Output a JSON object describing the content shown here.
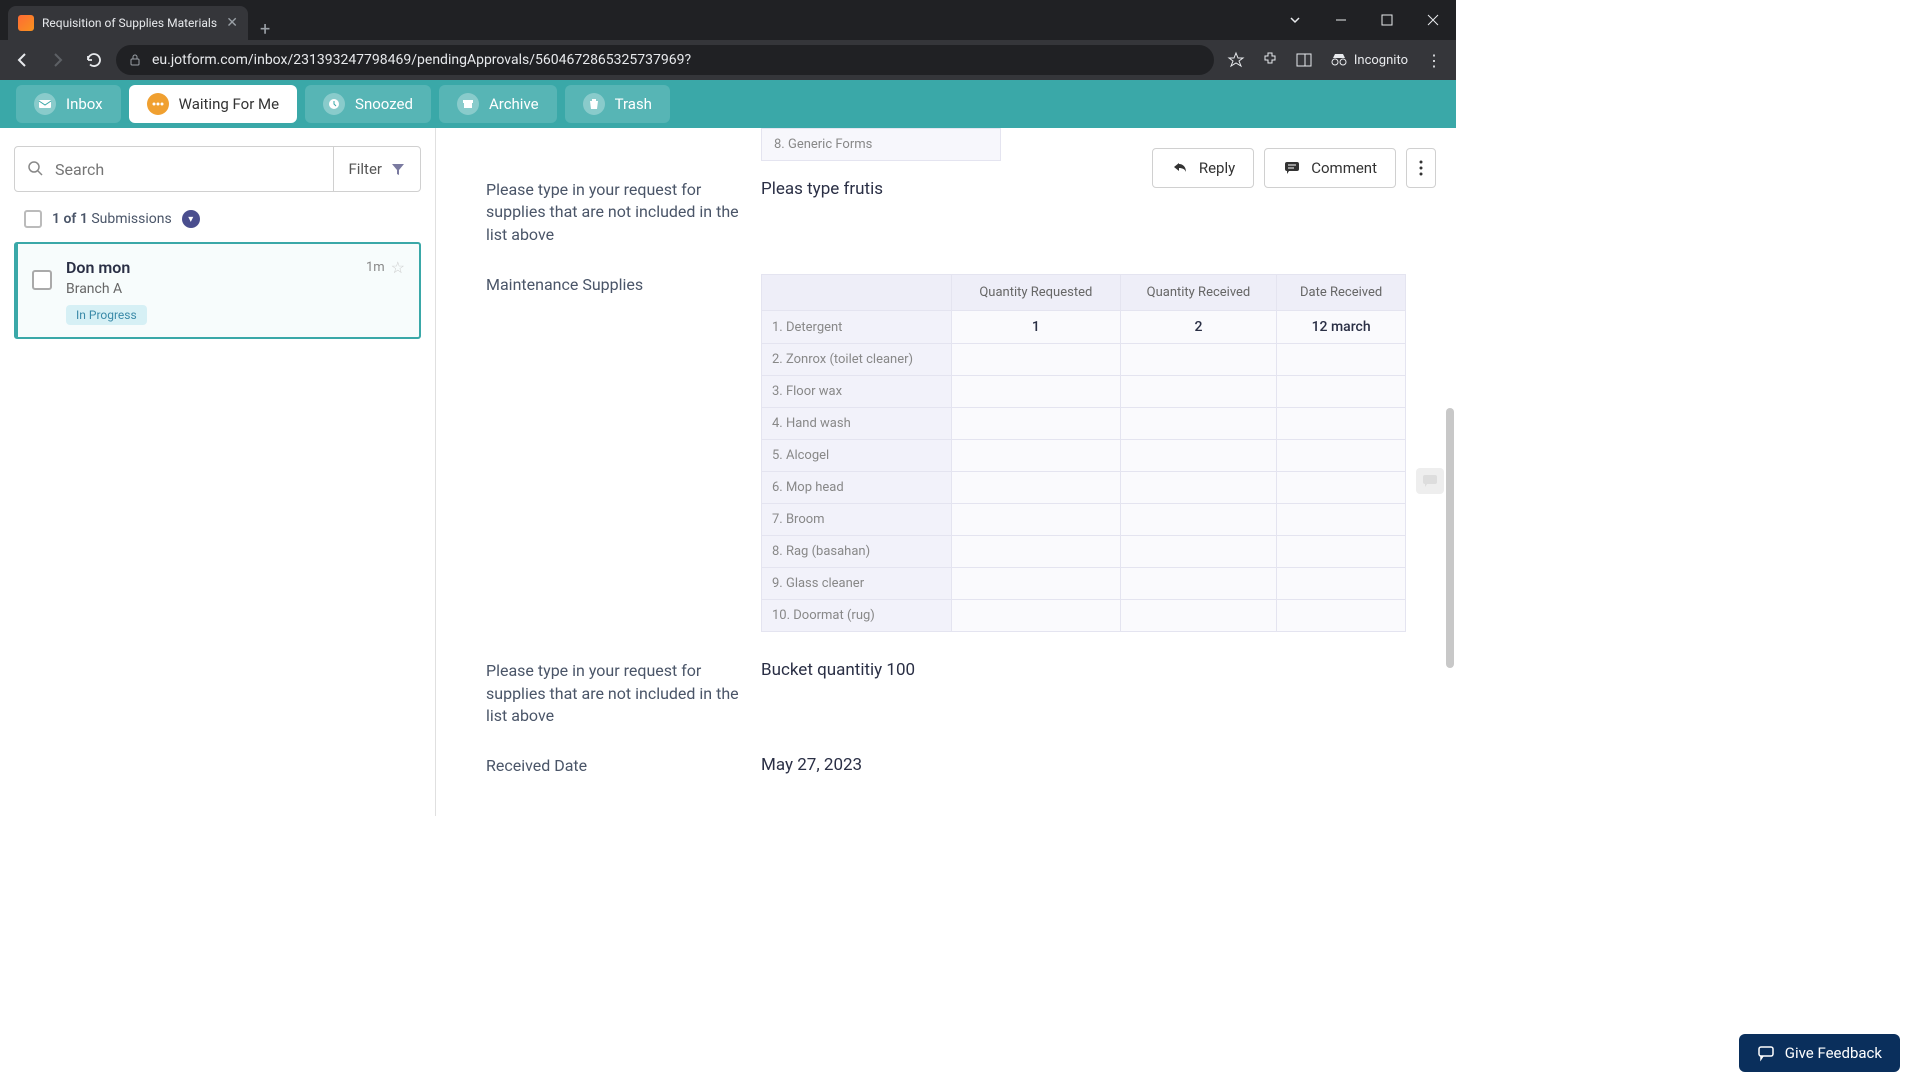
{
  "browser": {
    "tab_title": "Requisition of Supplies Materials",
    "url_display": "eu.jotform.com/inbox/231393247798469/pendingApprovals/5604672865325737969?",
    "incognito_label": "Incognito"
  },
  "nav": {
    "inbox": "Inbox",
    "waiting": "Waiting For Me",
    "snoozed": "Snoozed",
    "archive": "Archive",
    "trash": "Trash"
  },
  "sidebar": {
    "search_placeholder": "Search",
    "filter_label": "Filter",
    "count_prefix": "1 of 1",
    "count_suffix": "Submissions",
    "card": {
      "name": "Don mon",
      "time": "1m",
      "branch": "Branch A",
      "status": "In Progress"
    }
  },
  "toolbar": {
    "reply": "Reply",
    "comment": "Comment"
  },
  "content": {
    "generic_forms_row": "8. Generic Forms",
    "q1_label": "Please type in your request for supplies that are not included in the list above",
    "q1_value": "Pleas type frutis",
    "maint_label": "Maintenance Supplies",
    "maint_headers": [
      "",
      "Quantity Requested",
      "Quantity Received",
      "Date Received"
    ],
    "maint_rows": [
      {
        "label": "1. Detergent",
        "req": "1",
        "recv": "2",
        "date": "12 march"
      },
      {
        "label": "2. Zonrox (toilet cleaner)",
        "req": "",
        "recv": "",
        "date": ""
      },
      {
        "label": "3. Floor wax",
        "req": "",
        "recv": "",
        "date": ""
      },
      {
        "label": "4. Hand wash",
        "req": "",
        "recv": "",
        "date": ""
      },
      {
        "label": "5. Alcogel",
        "req": "",
        "recv": "",
        "date": ""
      },
      {
        "label": "6. Mop head",
        "req": "",
        "recv": "",
        "date": ""
      },
      {
        "label": "7. Broom",
        "req": "",
        "recv": "",
        "date": ""
      },
      {
        "label": "8. Rag (basahan)",
        "req": "",
        "recv": "",
        "date": ""
      },
      {
        "label": "9. Glass cleaner",
        "req": "",
        "recv": "",
        "date": ""
      },
      {
        "label": "10. Doormat (rug)",
        "req": "",
        "recv": "",
        "date": ""
      }
    ],
    "q2_label": "Please type in your request for supplies that are not included in the list above",
    "q2_value": "Bucket quantitiy 100",
    "received_label": "Received Date",
    "received_value": "May 27, 2023"
  },
  "feedback": "Give Feedback"
}
